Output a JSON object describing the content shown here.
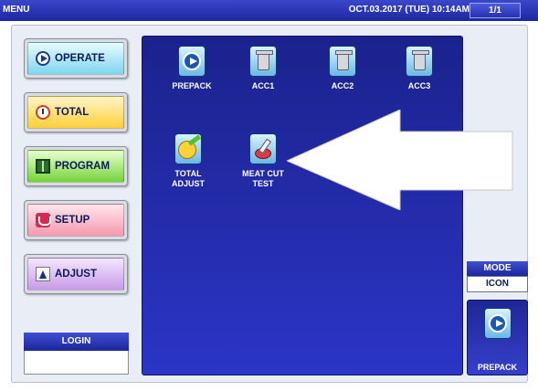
{
  "header": {
    "title": "MENU",
    "datetime": "OCT.03.2017 (TUE) 10:14AM",
    "page": "1/1"
  },
  "sidebar": {
    "buttons": [
      {
        "label": "OPERATE",
        "icon": "play-circle-icon"
      },
      {
        "label": "TOTAL",
        "icon": "clock-icon"
      },
      {
        "label": "PROGRAM",
        "icon": "book-icon"
      },
      {
        "label": "SETUP",
        "icon": "setup-icon"
      },
      {
        "label": "ADJUST",
        "icon": "adjust-icon"
      }
    ],
    "login": {
      "label": "LOGIN",
      "value": ""
    }
  },
  "main": {
    "tiles": [
      {
        "label": "PREPACK",
        "icon": "play-circle-icon"
      },
      {
        "label": "ACC1",
        "icon": "trash-icon"
      },
      {
        "label": "ACC2",
        "icon": "trash-icon"
      },
      {
        "label": "ACC3",
        "icon": "trash-icon"
      },
      {
        "label": "TOTAL\nADJUST",
        "icon": "pie-chart-icon"
      },
      {
        "label": "MEAT CUT\nTEST",
        "icon": "meat-knife-icon"
      }
    ]
  },
  "right": {
    "mode": {
      "label": "MODE",
      "value": "ICON"
    },
    "shortcut": {
      "label": "PREPACK",
      "icon": "play-circle-icon"
    }
  },
  "colors": {
    "header_blue": "#1c27a0",
    "panel_blue": "#2b35c6",
    "operate": "#7fd5ee",
    "total": "#ffcf3a",
    "program": "#74d43a",
    "setup": "#f49aae",
    "adjust": "#c79be8"
  }
}
